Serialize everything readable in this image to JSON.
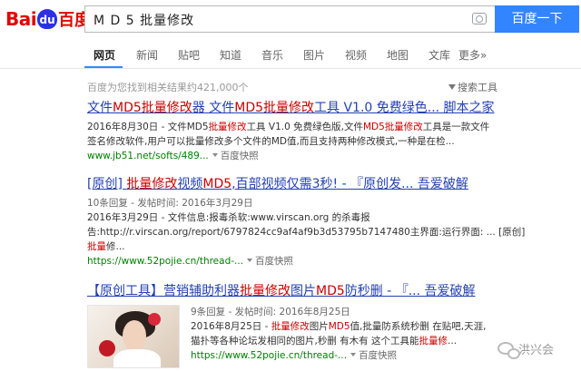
{
  "header": {
    "logo_left": "Bai",
    "logo_paw": "du",
    "logo_right": "百度",
    "search_value": "M D 5 批量修改",
    "search_button": "百度一下"
  },
  "tabs": [
    {
      "label": "网页",
      "active": true
    },
    {
      "label": "新闻"
    },
    {
      "label": "贴吧"
    },
    {
      "label": "知道"
    },
    {
      "label": "音乐"
    },
    {
      "label": "图片"
    },
    {
      "label": "视频"
    },
    {
      "label": "地图"
    },
    {
      "label": "文库"
    },
    {
      "label": "更多»"
    }
  ],
  "stats": "百度为您找到相关结果约421,000个",
  "search_tools": "搜索工具",
  "results": [
    {
      "title": [
        "文件",
        "MD5批量修改",
        "器 文件",
        "MD5批量修改",
        "工具 V1.0 免费绿色... 脚本之家"
      ],
      "date_line": [
        "2016年8月30日 - 文件MD5",
        "批量修改",
        "工具 V1.0 免费绿色版,文件",
        "MD5批量修改",
        "工具是一款文件"
      ],
      "line2": "签名修改软件,用户可以批量修改多个文件的MD值,而且支持两种修改模式,一种是在检...",
      "url": "www.jb51.net/softs/489...",
      "snapshot": "百度快照"
    },
    {
      "title": [
        "[原创] ",
        "批量修改",
        "视频",
        "MD5",
        ",百部视频仅需3秒! - 『原创发... 吾爱破解"
      ],
      "meta": "10条回复 - 发帖时间: 2016年3月29日",
      "date_line": "2016年3月29日 - 文件信息:报毒杀软:www.virscan.org 的杀毒报",
      "line2": "告:http://r.virscan.org/report/6797824cc9af4af9b3d53795b7147480主界面:运行界面: ... [原创]",
      "line3": [
        "批量",
        "修..."
      ],
      "url": "https://www.52pojie.cn/thread-...",
      "snapshot": "百度快照"
    },
    {
      "title": [
        "【原创工具】营销辅助利器",
        "批量修改",
        "图片",
        "MD5",
        "防秒删 - 『... 吾爱破解"
      ],
      "meta": "9条回复 - 发帖时间: 2016年8月25日",
      "date_line": [
        "2016年8月25日 - ",
        "批量修改",
        "图片",
        "MD5",
        "值,批量防系统秒删 在贴吧,天涯,"
      ],
      "line2": [
        "猫扑等各种论坛发相同的图片,秒删 有木有 这个工具能",
        "批量修",
        "..."
      ],
      "url": "https://www.52pojie.cn/thread-...",
      "snapshot": "百度快照"
    }
  ],
  "watermark": "洪兴会"
}
